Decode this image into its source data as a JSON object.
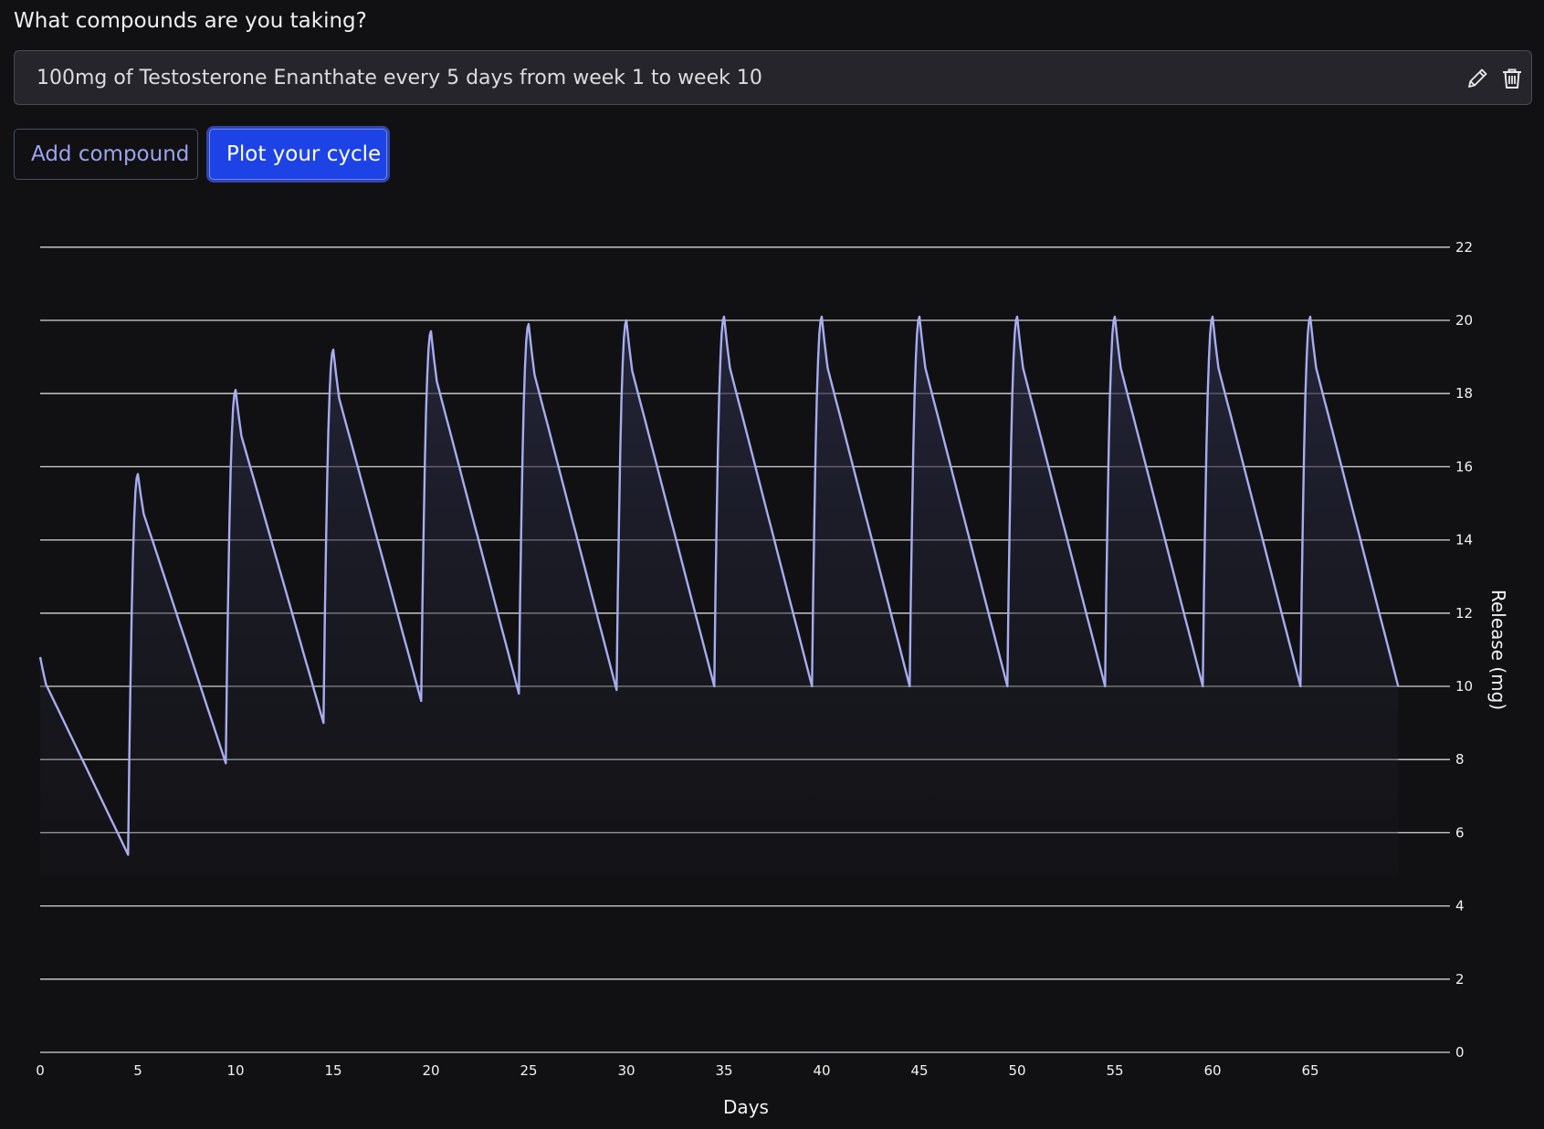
{
  "form": {
    "question": "What compounds are you taking?",
    "compounds": [
      {
        "description": "100mg of Testosterone Enanthate every 5 days from week 1 to week 10",
        "edit_icon": "pencil-icon",
        "delete_icon": "trash-icon"
      }
    ],
    "add_compound_label": "Add compound",
    "plot_label": "Plot your cycle"
  },
  "colors": {
    "background": "#111113",
    "line": "#a7adf0",
    "primary_button": "#1d43e6",
    "grid": "#d9d9d9"
  },
  "chart_data": {
    "type": "area",
    "xlabel": "Days",
    "ylabel": "Release (mg)",
    "x_ticks": [
      0,
      5,
      10,
      15,
      20,
      25,
      30,
      35,
      40,
      45,
      50,
      55,
      60,
      65
    ],
    "y_ticks": [
      0,
      2,
      4,
      6,
      8,
      10,
      12,
      14,
      16,
      18,
      20,
      22
    ],
    "xlim": [
      0,
      69.5
    ],
    "ylim": [
      0,
      22
    ],
    "grid": true,
    "y_axis_side": "right",
    "series": [
      {
        "x": [
          0,
          4.5,
          5,
          9.5,
          10,
          14.5,
          15,
          19.5,
          20,
          24.5,
          25,
          29.5,
          30,
          34.5,
          35,
          39.5,
          40,
          44.5,
          45,
          49.5,
          50,
          54.5,
          55,
          59.5,
          60,
          64.5,
          65,
          69.5
        ],
        "y": [
          10.8,
          5.4,
          15.8,
          7.9,
          18.1,
          9.0,
          19.2,
          9.6,
          19.7,
          9.8,
          19.9,
          9.9,
          20.0,
          10.0,
          20.1,
          10.0,
          20.1,
          10.0,
          20.1,
          10.0,
          20.1,
          10.0,
          20.1,
          10.0,
          20.1,
          10.0,
          20.1,
          10.0
        ]
      }
    ]
  }
}
